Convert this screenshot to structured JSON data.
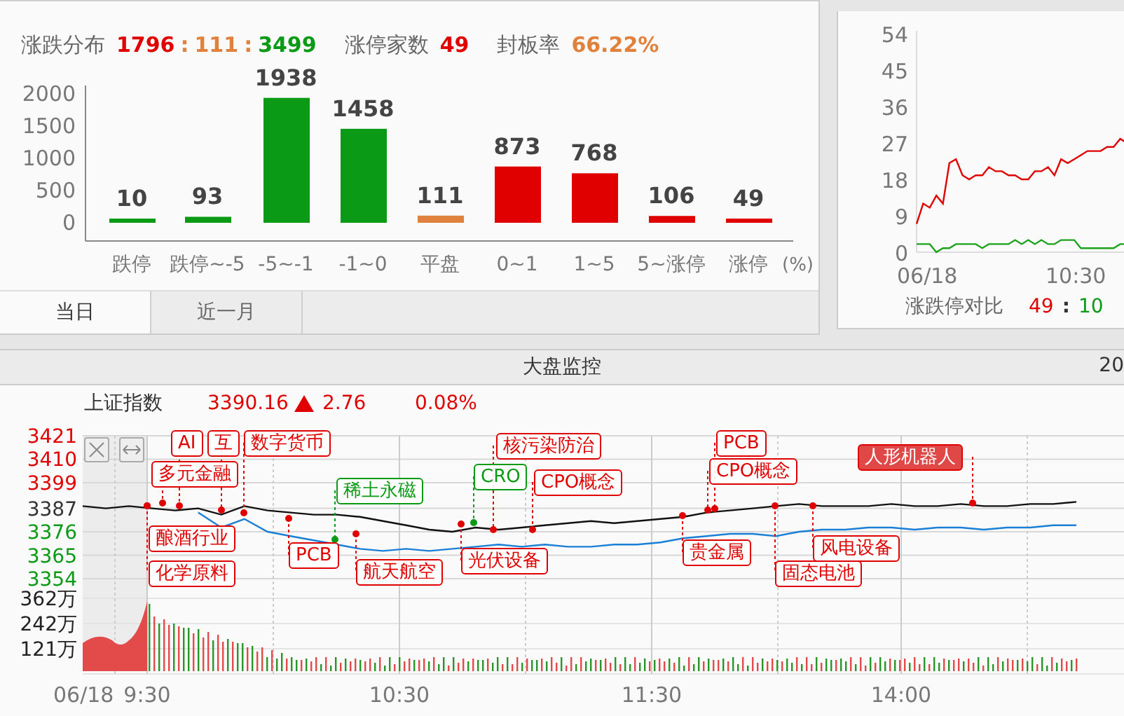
{
  "distribution_panel": {
    "stats": {
      "label": "涨跌分布",
      "up": "1796",
      "sep_1": ":",
      "flat": "111",
      "sep_2": ":",
      "down": "3499",
      "limit_up_label": "涨停家数",
      "limit_up": "49",
      "seal_label": "封板率",
      "seal_rate": "66.22%"
    },
    "chart_data": {
      "type": "bar",
      "categories": [
        "跌停",
        "跌停~-5",
        "-5~-1",
        "-1~0",
        "平盘",
        "0~1",
        "1~5",
        "5~涨停",
        "涨停"
      ],
      "xlabel": "(%)",
      "series": [
        {
          "color": "#0a9a16",
          "values": [
            10,
            93,
            1938,
            1458,
            null,
            null,
            null,
            null,
            null
          ]
        },
        {
          "color": "#e0823d",
          "values": [
            null,
            null,
            null,
            null,
            111,
            null,
            null,
            null,
            null
          ]
        },
        {
          "color": "#e00000",
          "values": [
            null,
            null,
            null,
            null,
            null,
            873,
            768,
            106,
            49
          ]
        }
      ],
      "ylim": [
        0,
        2000
      ],
      "yticks": [
        0,
        500,
        1000,
        1500,
        2000
      ],
      "data_labels": true
    },
    "tabs": [
      {
        "label": "当日",
        "selected": true
      },
      {
        "label": "近一月",
        "selected": false
      }
    ]
  },
  "limit_panel": {
    "chart_data": {
      "type": "line",
      "series": [
        {
          "color": "#e00000",
          "values": [
            7,
            12,
            11,
            14,
            12,
            22,
            23,
            19,
            18,
            19,
            19,
            21,
            20,
            20,
            19,
            19,
            18,
            18,
            20,
            20,
            21,
            19,
            23,
            22,
            23,
            24,
            25,
            25,
            25,
            26,
            26,
            28,
            27
          ]
        },
        {
          "color": "#1aa31a",
          "values": [
            2,
            2,
            2,
            0,
            1,
            1,
            2,
            2,
            2,
            2,
            1,
            2,
            2,
            2,
            2,
            3,
            2,
            3,
            2,
            3,
            2,
            2,
            3,
            3,
            3,
            1,
            1,
            1,
            1,
            1,
            1,
            2,
            2
          ]
        }
      ],
      "ylim": [
        0,
        54
      ],
      "yticks": [
        0,
        9,
        18,
        27,
        36,
        45,
        54
      ]
    },
    "time_labels": [
      "06/18",
      "10:30"
    ],
    "footer": {
      "label": "涨跌停对比",
      "up": "49",
      "sep": ":",
      "down": "10"
    }
  },
  "monitor": {
    "title": "大盘监控",
    "corner_text": "20",
    "index": {
      "name": "上证指数",
      "price": "3390.16",
      "change": "2.76",
      "percent": "0.08%"
    },
    "chart_data": {
      "type": "line",
      "series": [
        {
          "color": "#111111",
          "values": [
            3388,
            3387,
            3388,
            3387,
            3386,
            3387,
            3384,
            3388,
            3386,
            3385,
            3384,
            3384,
            3383,
            3381,
            3379,
            3377,
            3376,
            3378,
            3377,
            3378,
            3379,
            3380,
            3381,
            3380,
            3381,
            3382,
            3383,
            3385,
            3386,
            3387,
            3388,
            3389,
            3388,
            3388,
            3388,
            3389,
            3388,
            3388,
            3389,
            3388,
            3388,
            3389,
            3389,
            3390
          ]
        },
        {
          "color": "#1a7fd6",
          "values": [
            null,
            null,
            null,
            null,
            null,
            3385,
            3378,
            3382,
            3376,
            3374,
            3372,
            3370,
            3368,
            3367,
            3368,
            3367,
            3368,
            3369,
            3370,
            3369,
            3370,
            3369,
            3369,
            3370,
            3370,
            3371,
            3373,
            3374,
            3375,
            3375,
            3374,
            3376,
            3377,
            3377,
            3378,
            3378,
            3377,
            3378,
            3378,
            3377,
            3378,
            3378,
            3379,
            3379
          ]
        }
      ],
      "ylim": [
        3354,
        3421
      ],
      "yticks": [
        3354,
        3365,
        3376,
        3387,
        3399,
        3410,
        3421
      ],
      "grid": true
    },
    "time_labels": [
      "06/18",
      "9:30",
      "10:30",
      "11:30",
      "14:00"
    ],
    "volume_ticks": [
      "362万",
      "242万",
      "121万"
    ],
    "tags": [
      {
        "label": "AI",
        "color": "#e00000",
        "selected": false
      },
      {
        "label": "互",
        "color": "#e00000",
        "selected": false
      },
      {
        "label": "数字货币",
        "color": "#e00000",
        "selected": false
      },
      {
        "label": "多元金融",
        "color": "#e00000",
        "selected": false
      },
      {
        "label": "稀土永磁",
        "color": "#0a9a16",
        "selected": false
      },
      {
        "label": "核污染防治",
        "color": "#e00000",
        "selected": false
      },
      {
        "label": "CRO",
        "color": "#0a9a16",
        "selected": false
      },
      {
        "label": "CPO概念",
        "color": "#e00000",
        "selected": false
      },
      {
        "label": "PCB",
        "color": "#e00000",
        "selected": false
      },
      {
        "label": "CPO概念",
        "color": "#e00000",
        "selected": false
      },
      {
        "label": "人形机器人",
        "color": "#e00000",
        "selected": true
      },
      {
        "label": "酿酒行业",
        "color": "#e00000",
        "selected": false
      },
      {
        "label": "化学原料",
        "color": "#e00000",
        "selected": false
      },
      {
        "label": "PCB",
        "color": "#e00000",
        "selected": false
      },
      {
        "label": "航天航空",
        "color": "#e00000",
        "selected": false
      },
      {
        "label": "光伏设备",
        "color": "#e00000",
        "selected": false
      },
      {
        "label": "贵金属",
        "color": "#e00000",
        "selected": false
      },
      {
        "label": "风电设备",
        "color": "#e00000",
        "selected": false
      },
      {
        "label": "固态电池",
        "color": "#e00000",
        "selected": false
      }
    ]
  }
}
